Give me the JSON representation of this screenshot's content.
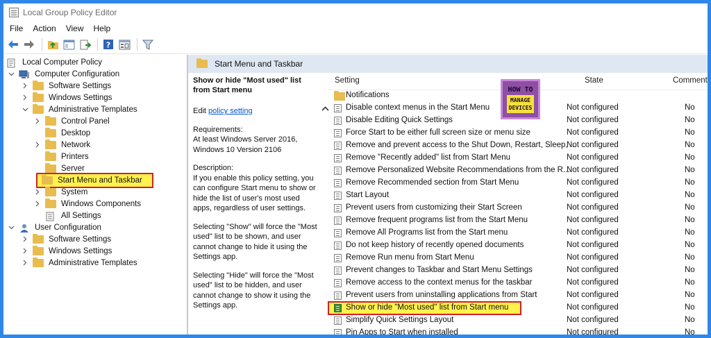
{
  "window": {
    "title": "Local Group Policy Editor"
  },
  "menu": [
    "File",
    "Action",
    "View",
    "Help"
  ],
  "toolbar": {
    "buttons": [
      "back-arrow-icon",
      "forward-arrow-icon",
      "up-folder-icon",
      "show-hide-tree-icon",
      "export-list-icon",
      "help-icon",
      "properties-icon",
      "filter-icon"
    ]
  },
  "tree": {
    "root": "Local Computer Policy",
    "computer_configuration": "Computer Configuration",
    "software_settings": "Software Settings",
    "windows_settings": "Windows Settings",
    "administrative_templates": "Administrative Templates",
    "control_panel": "Control Panel",
    "desktop": "Desktop",
    "network": "Network",
    "printers": "Printers",
    "server": "Server",
    "start_menu_and_taskbar": "Start Menu and Taskbar",
    "system": "System",
    "windows_components": "Windows Components",
    "all_settings": "All Settings",
    "user_configuration": "User Configuration",
    "user_software_settings": "Software Settings",
    "user_windows_settings": "Windows Settings",
    "user_administrative_templates": "Administrative Templates"
  },
  "right_pane": {
    "header": "Start Menu and Taskbar"
  },
  "description": {
    "title": "Show or hide \"Most used\" list from Start menu",
    "edit_prefix": "Edit ",
    "edit_link": "policy setting",
    "requirements_label": "Requirements:",
    "requirements": "At least Windows Server 2016, Windows 10 Version 2106",
    "description_label": "Description:",
    "description_text": "If you enable this policy setting, you can configure Start menu to show or hide the list of user's most used apps, regardless of user settings.",
    "show_text": "Selecting \"Show\" will force the \"Most used\" list to be shown, and user cannot change to hide it using the Settings app.",
    "hide_text": "Selecting \"Hide\" will force the \"Most used\" list to be hidden, and user cannot change to show it using the Settings app."
  },
  "list": {
    "headers": {
      "setting": "Setting",
      "state": "State",
      "comment": "Comment"
    },
    "folder": "Notifications",
    "rows": [
      {
        "name": "Disable context menus in the Start Menu",
        "state": "Not configured",
        "comment": "No"
      },
      {
        "name": "Disable Editing Quick Settings",
        "state": "Not configured",
        "comment": "No"
      },
      {
        "name": "Force Start to be either full screen size or menu size",
        "state": "Not configured",
        "comment": "No"
      },
      {
        "name": "Remove and prevent access to the Shut Down, Restart, Sleep, ...",
        "state": "Not configured",
        "comment": "No"
      },
      {
        "name": "Remove \"Recently added\" list from Start Menu",
        "state": "Not configured",
        "comment": "No"
      },
      {
        "name": "Remove Personalized Website Recommendations from the R...",
        "state": "Not configured",
        "comment": "No"
      },
      {
        "name": "Remove Recommended section from Start Menu",
        "state": "Not configured",
        "comment": "No"
      },
      {
        "name": "Start Layout",
        "state": "Not configured",
        "comment": "No"
      },
      {
        "name": "Prevent users from customizing their Start Screen",
        "state": "Not configured",
        "comment": "No"
      },
      {
        "name": "Remove frequent programs list from the Start Menu",
        "state": "Not configured",
        "comment": "No"
      },
      {
        "name": "Remove All Programs list from the Start menu",
        "state": "Not configured",
        "comment": "No"
      },
      {
        "name": "Do not keep history of recently opened documents",
        "state": "Not configured",
        "comment": "No"
      },
      {
        "name": "Remove Run menu from Start Menu",
        "state": "Not configured",
        "comment": "No"
      },
      {
        "name": "Prevent changes to Taskbar and Start Menu Settings",
        "state": "Not configured",
        "comment": "No"
      },
      {
        "name": "Remove access to the context menus for the taskbar",
        "state": "Not configured",
        "comment": "No"
      },
      {
        "name": "Prevent users from uninstalling applications from Start",
        "state": "Not configured",
        "comment": "No"
      },
      {
        "name": "Show or hide \"Most used\" list from Start menu",
        "state": "Not configured",
        "comment": "No"
      },
      {
        "name": "Simplify Quick Settings Layout",
        "state": "Not configured",
        "comment": "No"
      },
      {
        "name": "Pin Apps to Start when installed",
        "state": "Not configured",
        "comment": "No"
      }
    ]
  },
  "logo": {
    "line1": "HOW TO",
    "line2": "MANAGE",
    "line3": "DEVICES"
  },
  "colors": {
    "highlight_yellow": "#fff24d",
    "highlight_border": "#d21f2a",
    "header_band": "#dfe7f3",
    "frame_blue": "#2f88e8"
  }
}
